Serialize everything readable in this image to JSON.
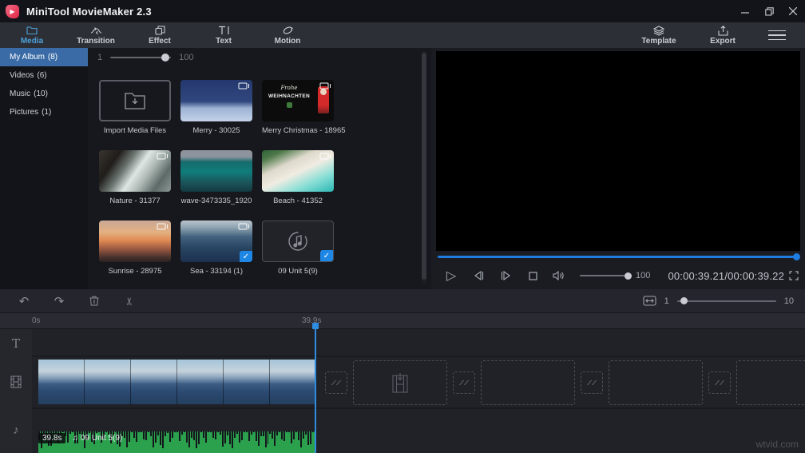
{
  "title_bar": {
    "app_title": "MiniTool MovieMaker 2.3"
  },
  "toolbar": {
    "tabs": [
      {
        "label": "Media",
        "icon": "folder-icon",
        "active": true
      },
      {
        "label": "Transition",
        "icon": "transition-icon",
        "active": false
      },
      {
        "label": "Effect",
        "icon": "effect-icon",
        "active": false
      },
      {
        "label": "Text",
        "icon": "text-icon",
        "active": false
      },
      {
        "label": "Motion",
        "icon": "motion-icon",
        "active": false
      }
    ],
    "right": [
      {
        "label": "Template",
        "icon": "layers-icon"
      },
      {
        "label": "Export",
        "icon": "export-icon"
      }
    ]
  },
  "sidebar": {
    "items": [
      {
        "label": "My Album",
        "count": "(8)",
        "active": true
      },
      {
        "label": "Videos",
        "count": "(6)",
        "active": false
      },
      {
        "label": "Music",
        "count": "(10)",
        "active": false
      },
      {
        "label": "Pictures",
        "count": "(1)",
        "active": false
      }
    ]
  },
  "media_panel": {
    "zoom_min": "1",
    "zoom_max": "100",
    "items": [
      {
        "label": "Import Media Files",
        "type": "import",
        "thumb": "import"
      },
      {
        "label": "Merry - 30025",
        "type": "video",
        "thumb": "merry",
        "badge": true
      },
      {
        "label": "Merry Christmas - 18965",
        "type": "video",
        "thumb": "santa",
        "badge": true,
        "thumb_text": [
          "Frohe",
          "WEIHNACHTEN"
        ]
      },
      {
        "label": "Nature - 31377",
        "type": "video",
        "thumb": "nature",
        "badge": true
      },
      {
        "label": "wave-3473335_1920",
        "type": "video",
        "thumb": "wave",
        "badge": false
      },
      {
        "label": "Beach - 41352",
        "type": "video",
        "thumb": "beach",
        "badge": true
      },
      {
        "label": "Sunrise - 28975",
        "type": "video",
        "thumb": "sunrise",
        "badge": true
      },
      {
        "label": "Sea - 33194 (1)",
        "type": "video",
        "thumb": "sea",
        "badge": true,
        "checked": true
      },
      {
        "label": "09 Unit 5(9)",
        "type": "audio",
        "thumb": "music",
        "checked": true
      }
    ]
  },
  "preview": {
    "volume": "100",
    "time": "00:00:39.21/00:00:39.22"
  },
  "timeline": {
    "zoom_min": "1",
    "zoom_max": "10",
    "ruler_start": "0s",
    "playhead_time": "39.9s",
    "audio_clip": {
      "duration": "39.8s",
      "name": "09 Unit 5(9)"
    }
  },
  "icons": {
    "undo": "↶",
    "redo": "↷",
    "scissors": "✂",
    "text_track": "T",
    "music_note": "♫",
    "music_note_single": "♪",
    "play": "▷",
    "check": "✓"
  },
  "watermark": "wtvid.com",
  "colors": {
    "accent_blue": "#2e8de0",
    "active_tab_blue": "#4f9fd8",
    "sidebar_active_blue": "#3a6ba6",
    "audio_green": "#2ba14e",
    "seekbar_blue": "#1f7ce0",
    "check_badge_blue": "#1e87e5"
  }
}
